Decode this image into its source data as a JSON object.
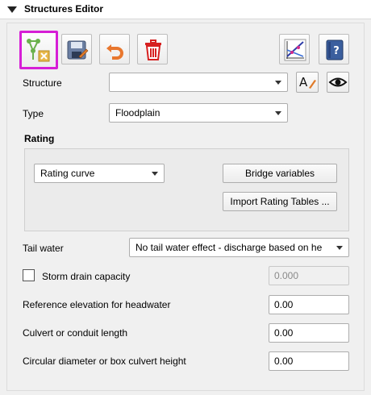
{
  "panel": {
    "title": "Structures Editor"
  },
  "toolbar": {
    "add_structure": {
      "icon": "add-structure-icon"
    },
    "save": {
      "icon": "save-icon"
    },
    "undo": {
      "icon": "undo-icon"
    },
    "delete": {
      "icon": "trash-icon"
    },
    "profile": {
      "icon": "profile-chart-icon"
    },
    "help": {
      "icon": "help-book-icon"
    },
    "selection_color": "#d61ed6"
  },
  "structure": {
    "label": "Structure",
    "value": "",
    "rename_icon": "rename-text-icon",
    "view_icon": "eye-icon"
  },
  "type": {
    "label": "Type",
    "value": "Floodplain"
  },
  "rating": {
    "label": "Rating",
    "method": "Rating curve",
    "bridge_button": "Bridge variables",
    "import_button": "Import Rating Tables ..."
  },
  "tail_water": {
    "label": "Tail water",
    "value": "No tail water effect - discharge based on he"
  },
  "storm_drain": {
    "label": "Storm drain capacity",
    "checked": false,
    "value": "0.000"
  },
  "reference_elevation": {
    "label": "Reference elevation for headwater",
    "value": "0.00"
  },
  "culvert_length": {
    "label": "Culvert or conduit length",
    "value": "0.00"
  },
  "circular_diameter": {
    "label": "Circular diameter or box culvert height",
    "value": "0.00"
  }
}
